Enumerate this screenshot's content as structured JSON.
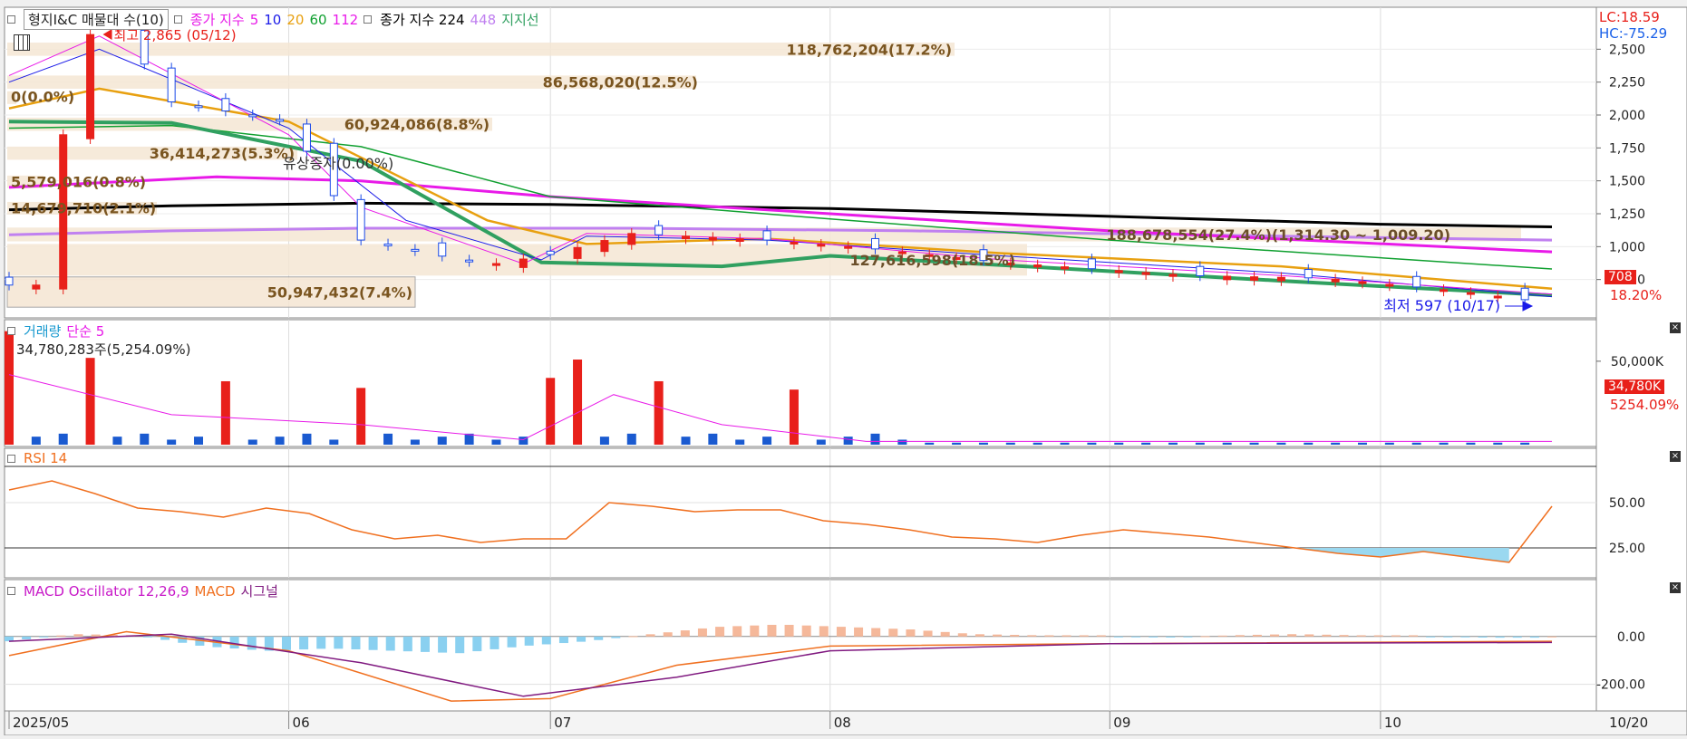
{
  "price_panel": {
    "title": "형지I&C 매물대 수(10)",
    "ma_label": "종가 지수",
    "ma_periods": [
      {
        "label": "5",
        "color": "#e81ae8"
      },
      {
        "label": "10",
        "color": "#1a1ae8"
      },
      {
        "label": "20",
        "color": "#e8a010"
      },
      {
        "label": "60",
        "color": "#10a030"
      },
      {
        "label": "112",
        "color": "#e81ae8"
      }
    ],
    "ma2_label": "종가 지수 224",
    "ma2_extra": "448",
    "ma2_extra_color": "#c080f0",
    "support_label": "지지선",
    "support_color": "#30a060",
    "lc_label": "LC:18.59",
    "hc_label": "HC:-75.29",
    "high_label": "최고 2,865 (05/12)",
    "low_label": "최저 597 (10/17)",
    "rights_label": "유상증자(0.00%)",
    "current_price": "708",
    "current_change": "18.20%",
    "y_ticks": [
      "2,500",
      "2,250",
      "2,000",
      "1,750",
      "1,500",
      "1,250",
      "1,000",
      "750"
    ]
  },
  "volume_profile": [
    {
      "label": "118,762,204(17.2%)"
    },
    {
      "label": "86,568,020(12.5%)"
    },
    {
      "label": "60,924,086(8.8%)"
    },
    {
      "label": "36,414,273(5.3%)"
    },
    {
      "label": "5,579,016(0.8%)"
    },
    {
      "label": "14,679,710(2.1%)"
    },
    {
      "label": "0(0.0%)"
    },
    {
      "label": "188,678,554(27.4%)(1,314.30 ~ 1,009.20)"
    },
    {
      "label": "127,616,598(18.5%)"
    },
    {
      "label": "50,947,432(7.4%)"
    }
  ],
  "volume_panel": {
    "title": "거래량",
    "ma_label": "단순 5",
    "info": "34,780,283주(5,254.09%)",
    "y_ticks": [
      "50,000K"
    ],
    "current_value": "34,780K",
    "current_pct": "5254.09%"
  },
  "rsi_panel": {
    "title": "RSI 14",
    "y_ticks": [
      "50.00",
      "25.00"
    ]
  },
  "macd_panel": {
    "title": "MACD Oscillator 12,26,9",
    "macd_label": "MACD",
    "signal_label": "시그널",
    "y_ticks": [
      "0.00",
      "-200.00"
    ]
  },
  "x_axis": {
    "labels": [
      "2025/05",
      "06",
      "07",
      "08",
      "09",
      "10"
    ],
    "right_label": "10/20"
  },
  "chart_data": [
    {
      "type": "line",
      "name": "price",
      "x": [
        "2025-05-08",
        "2025-05-12",
        "2025-05-20",
        "2025-06-02",
        "2025-06-10",
        "2025-06-24",
        "2025-07-01",
        "2025-07-10",
        "2025-07-25",
        "2025-08-05",
        "2025-08-20",
        "2025-09-10",
        "2025-09-25",
        "2025-10-10",
        "2025-10-17",
        "2025-10-20"
      ],
      "values": [
        1850,
        2865,
        2100,
        1950,
        1050,
        860,
        940,
        1100,
        1050,
        990,
        880,
        780,
        760,
        660,
        597,
        708
      ],
      "ylim": [
        500,
        2750
      ],
      "title": "형지I&C 매물대 수(10)"
    },
    {
      "type": "bar",
      "name": "volume",
      "categories": [
        "2025-05-02",
        "2025-05-12",
        "2025-05-26",
        "2025-06-09",
        "2025-07-01",
        "2025-07-04",
        "2025-07-14",
        "2025-07-28",
        "2025-10-20"
      ],
      "values": [
        68000,
        52000,
        38000,
        34000,
        40000,
        51000,
        38000,
        33000,
        34780
      ],
      "ylim": [
        0,
        70000
      ],
      "title": "거래량"
    },
    {
      "type": "line",
      "name": "RSI 14",
      "values": [
        57,
        62,
        55,
        47,
        45,
        42,
        47,
        44,
        35,
        30,
        32,
        28,
        30,
        30,
        50,
        48,
        45,
        46,
        46,
        40,
        38,
        35,
        31,
        30,
        28,
        32,
        35,
        33,
        31,
        28,
        25,
        22,
        20,
        23,
        20,
        17,
        48
      ],
      "ylim": [
        10,
        75
      ],
      "title": "RSI 14"
    },
    {
      "type": "bar",
      "name": "MACD Oscillator 12,26,9",
      "values": [
        -20,
        10,
        5,
        -40,
        -60,
        -50,
        -60,
        -70,
        -40,
        -20,
        10,
        40,
        50,
        40,
        30,
        10,
        5,
        0,
        -5,
        5,
        10,
        5,
        0,
        -5,
        0
      ],
      "ylim": [
        -300,
        200
      ],
      "title": "MACD Oscillator 12,26,9"
    }
  ]
}
